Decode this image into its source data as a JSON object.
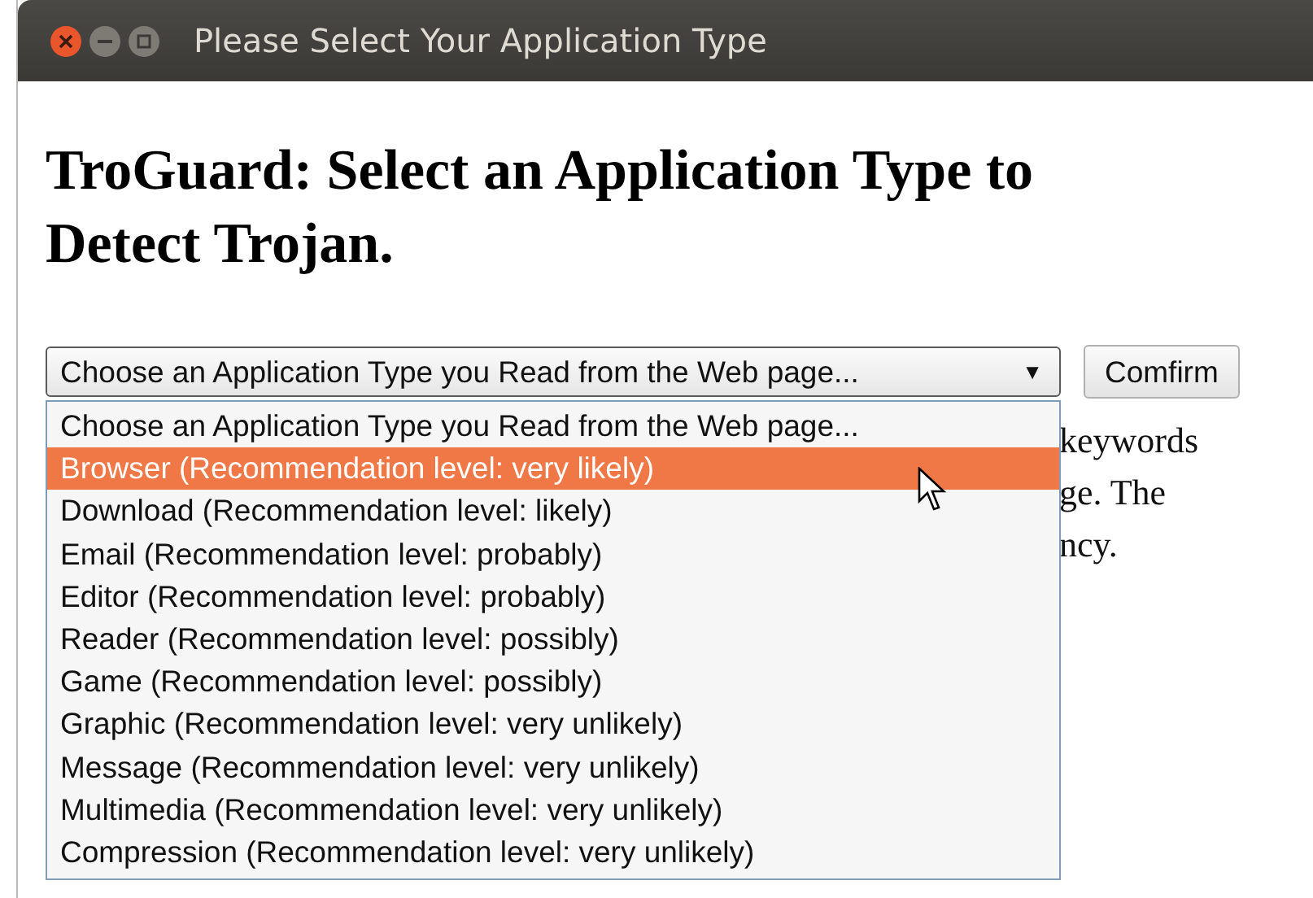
{
  "window": {
    "title": "Please Select Your Application Type"
  },
  "heading": "TroGuard: Select an Application Type to Detect Trojan.",
  "select": {
    "value": "Choose an Application Type you Read from the Web page...",
    "arrow": "▼",
    "expanded": true
  },
  "confirm_button": "Comfirm",
  "paragraph_visible_lines": [
    "keywords",
    "ge. The",
    "ncy."
  ],
  "options": [
    {
      "label": "Choose an Application Type you Read from the Web page...",
      "selected": false
    },
    {
      "label": "Browser (Recommendation level: very likely)",
      "selected": true
    },
    {
      "label": "Download (Recommendation level: likely)",
      "selected": false
    },
    {
      "label": "Email (Recommendation level: probably)",
      "selected": false
    },
    {
      "label": "Editor (Recommendation level: probably)",
      "selected": false
    },
    {
      "label": "Reader (Recommendation level: possibly)",
      "selected": false
    },
    {
      "label": "Game (Recommendation level: possibly)",
      "selected": false
    },
    {
      "label": "Graphic (Recommendation level: very unlikely)",
      "selected": false
    },
    {
      "label": "Message (Recommendation level: very unlikely)",
      "selected": false
    },
    {
      "label": "Multimedia (Recommendation level: very unlikely)",
      "selected": false
    },
    {
      "label": "Compression (Recommendation level: very unlikely)",
      "selected": false
    }
  ]
}
